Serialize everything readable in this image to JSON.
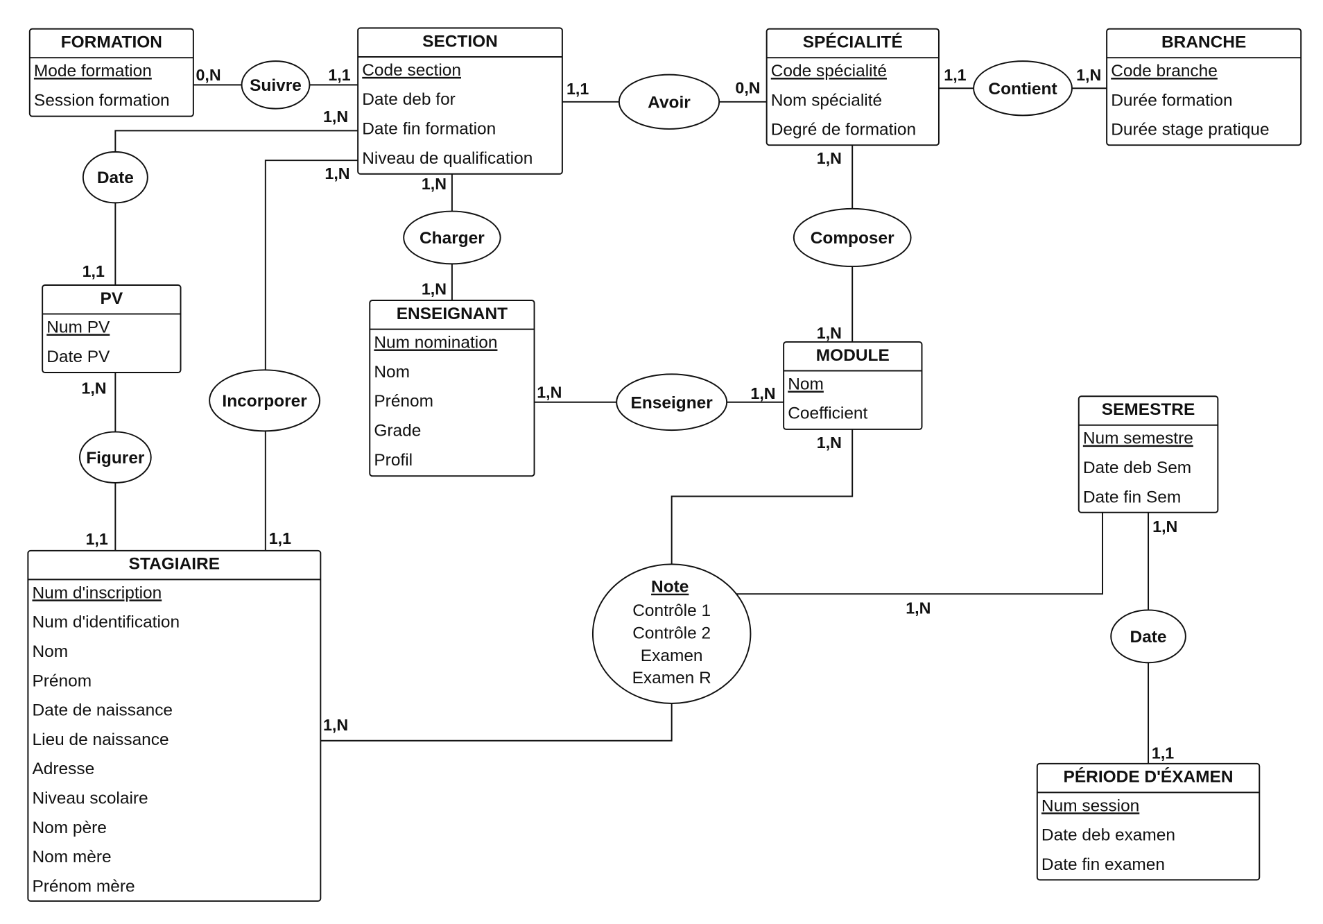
{
  "entities": {
    "formation": {
      "title": "FORMATION",
      "attributes": [
        {
          "name": "Mode formation",
          "key": true
        },
        {
          "name": "Session formation",
          "key": false
        }
      ]
    },
    "section": {
      "title": "SECTION",
      "attributes": [
        {
          "name": "Code section",
          "key": true
        },
        {
          "name": "Date deb for",
          "key": false
        },
        {
          "name": "Date fin formation",
          "key": false
        },
        {
          "name": "Niveau de qualification",
          "key": false
        }
      ]
    },
    "specialite": {
      "title": "SPÉCIALITÉ",
      "attributes": [
        {
          "name": "Code spécialité",
          "key": true
        },
        {
          "name": "Nom spécialité",
          "key": false
        },
        {
          "name": "Degré de formation",
          "key": false
        }
      ]
    },
    "branche": {
      "title": "BRANCHE",
      "attributes": [
        {
          "name": "Code branche",
          "key": true
        },
        {
          "name": "Durée formation",
          "key": false
        },
        {
          "name": "Durée stage pratique",
          "key": false
        }
      ]
    },
    "pv": {
      "title": "PV",
      "attributes": [
        {
          "name": "Num PV",
          "key": true
        },
        {
          "name": "Date PV",
          "key": false
        }
      ]
    },
    "enseignant": {
      "title": "ENSEIGNANT",
      "attributes": [
        {
          "name": "Num nomination",
          "key": true
        },
        {
          "name": "Nom",
          "key": false
        },
        {
          "name": "Prénom",
          "key": false
        },
        {
          "name": "Grade",
          "key": false
        },
        {
          "name": "Profil",
          "key": false
        }
      ]
    },
    "module": {
      "title": "MODULE",
      "attributes": [
        {
          "name": "Nom",
          "key": true
        },
        {
          "name": "Coefficient",
          "key": false
        }
      ]
    },
    "semestre": {
      "title": "SEMESTRE",
      "attributes": [
        {
          "name": "Num semestre",
          "key": true
        },
        {
          "name": "Date deb Sem",
          "key": false
        },
        {
          "name": "Date fin Sem",
          "key": false
        }
      ]
    },
    "stagiaire": {
      "title": "STAGIAIRE",
      "attributes": [
        {
          "name": "Num d'inscription",
          "key": true
        },
        {
          "name": "Num d'identification",
          "key": false
        },
        {
          "name": "Nom",
          "key": false
        },
        {
          "name": "Prénom",
          "key": false
        },
        {
          "name": "Date de naissance",
          "key": false
        },
        {
          "name": "Lieu de naissance",
          "key": false
        },
        {
          "name": "Adresse",
          "key": false
        },
        {
          "name": "Niveau scolaire",
          "key": false
        },
        {
          "name": "Nom père",
          "key": false
        },
        {
          "name": "Nom mère",
          "key": false
        },
        {
          "name": "Prénom mère",
          "key": false
        }
      ]
    },
    "periode": {
      "title": "PÉRIODE D'ÉXAMEN",
      "attributes": [
        {
          "name": "Num session",
          "key": true
        },
        {
          "name": "Date deb examen",
          "key": false
        },
        {
          "name": "Date fin examen",
          "key": false
        }
      ]
    }
  },
  "relations": {
    "suivre": {
      "name": "Suivre"
    },
    "avoir": {
      "name": "Avoir"
    },
    "contient": {
      "name": "Contient"
    },
    "date1": {
      "name": "Date"
    },
    "charger": {
      "name": "Charger"
    },
    "composer": {
      "name": "Composer"
    },
    "incorporer": {
      "name": "Incorporer"
    },
    "enseigner": {
      "name": "Enseigner"
    },
    "figurer": {
      "name": "Figurer"
    },
    "note": {
      "name": "Note",
      "attributes": [
        "Contrôle 1",
        "Contrôle 2",
        "Examen",
        "Examen R"
      ]
    },
    "date2": {
      "name": "Date"
    }
  },
  "cardinalities": {
    "formation_suivre": "0,N",
    "section_suivre": "1,1",
    "section_date": "1,N",
    "section_incorporer": "1,N",
    "section_charger": "1,N",
    "enseignant_charger": "1,N",
    "section_avoir": "1,1",
    "specialite_avoir": "0,N",
    "specialite_contient": "1,1",
    "branche_contient": "1,N",
    "specialite_composer": "1,N",
    "module_composer": "1,N",
    "pv_date": "1,1",
    "pv_figurer": "1,N",
    "stagiaire_figurer": "1,1",
    "stagiaire_incorporer": "1,1",
    "enseignant_enseigner": "1,N",
    "module_enseigner": "1,N",
    "module_note": "1,N",
    "semestre_date": "1,N",
    "semestre_note": "1,N",
    "stagiaire_note": "1,N",
    "periode_date": "1,1"
  }
}
